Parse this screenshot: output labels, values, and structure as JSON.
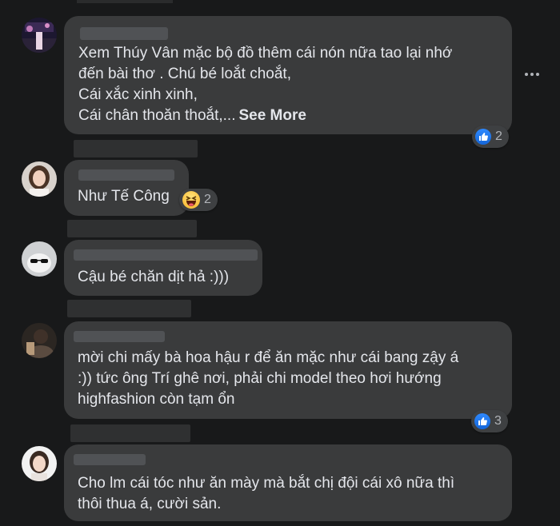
{
  "comments": [
    {
      "text": "Xem Thúy Vân mặc bộ đồ thêm cái nón nữa tao lại nhớ\nđến bài thơ . Chú bé loắt choắt,\nCái xắc xinh xinh,\nCái chân thoăn thoắt,...",
      "see_more": "See More",
      "reaction_count": "2",
      "reaction": "like"
    },
    {
      "text": "Như Tế Công",
      "reaction_count": "2",
      "reaction": "haha"
    },
    {
      "text": "Cậu bé chăn dịt hả :)))"
    },
    {
      "text": "mời chi mấy bà hoa hậu r để ăn mặc như cái bang zậy á\n:)) tức ông Trí ghê nơi, phải chi model theo hơi hướng\nhighfashion còn tạm ổn",
      "reaction_count": "3",
      "reaction": "like"
    },
    {
      "text": "Cho lm cái tóc như ăn mày mà bắt chị đội cái xô nữa thì\nthôi thua á, cười sản."
    }
  ],
  "colors": {
    "background": "#18191a",
    "bubble": "#3a3b3c",
    "like_blue": "#2e89ff"
  }
}
